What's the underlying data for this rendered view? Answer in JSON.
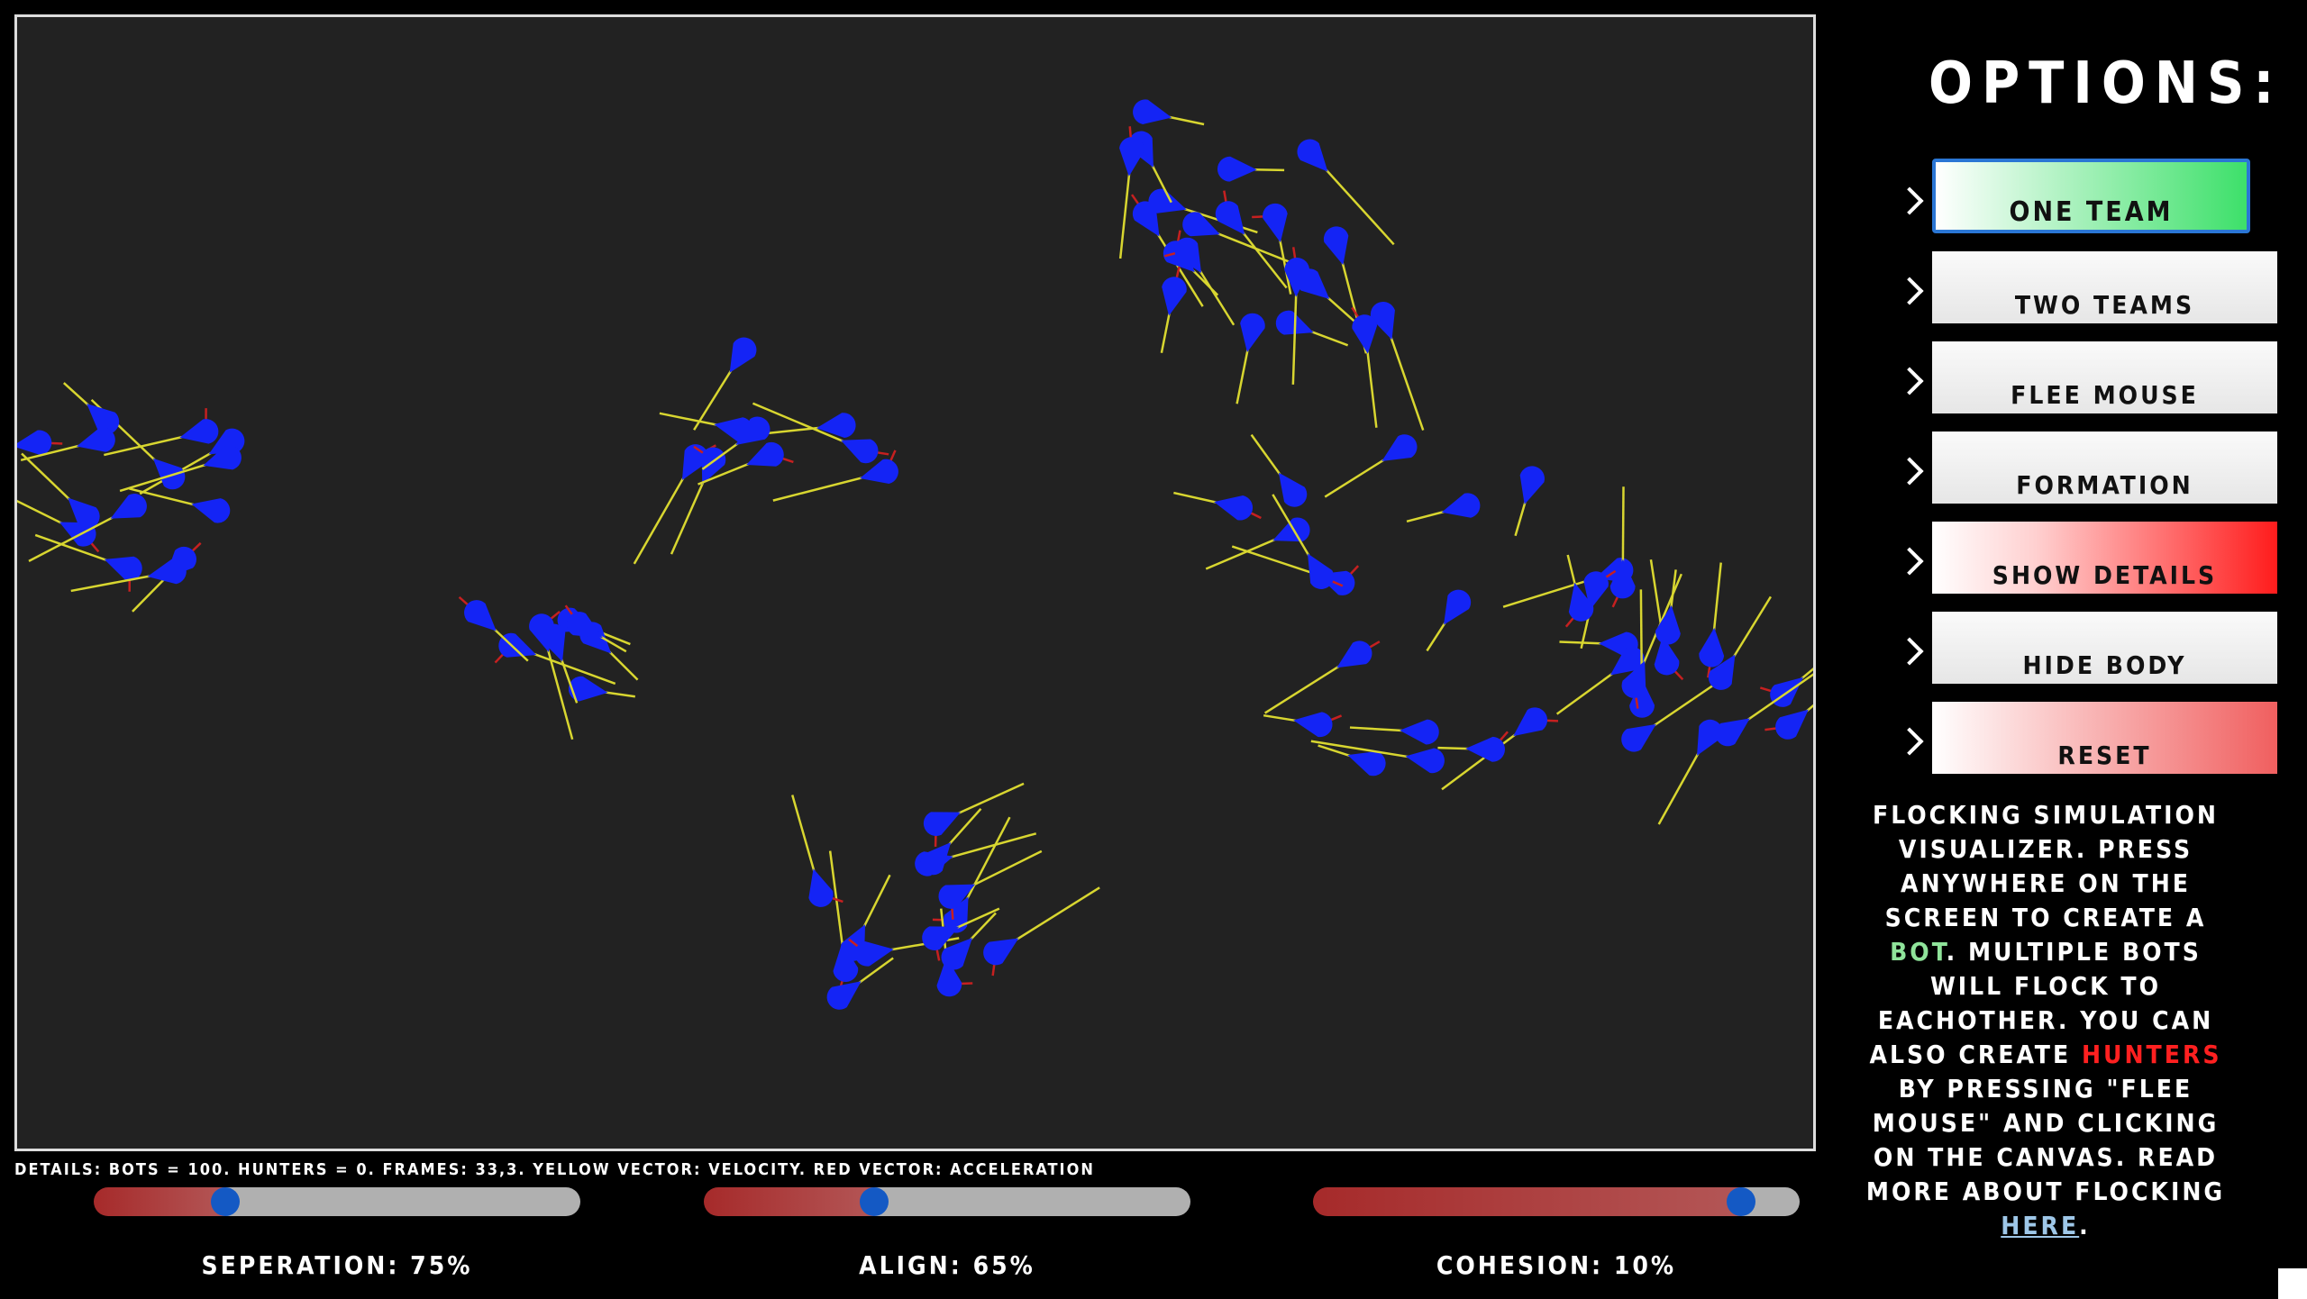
{
  "canvas": {
    "background": "#222222",
    "bot_color": "#1424f5",
    "velocity_color": "#d8d630",
    "acceleration_color": "#c62020"
  },
  "details_text": "DETAILS: BOTS = 100. HUNTERS = 0. FRAMES: 33,3. YELLOW VECTOR: VELOCITY. RED VECTOR: ACCELERATION",
  "sliders": [
    {
      "label": "SEPERATION: 75%",
      "value": 0.27
    },
    {
      "label": "ALIGN: 65%",
      "value": 0.35
    },
    {
      "label": "COHESION: 10%",
      "value": 0.88
    }
  ],
  "options": {
    "title": "OPTIONS:",
    "buttons": [
      {
        "label": "ONE TEAM",
        "color": "#3de06a"
      },
      {
        "label": "TWO TEAMS",
        "color": "#e6e6e6"
      },
      {
        "label": "FLEE MOUSE",
        "color": "#e6e6e6"
      },
      {
        "label": "FORMATION",
        "color": "#e6e6e6"
      },
      {
        "label": "SHOW DETAILS",
        "color": "#ff1c1c"
      },
      {
        "label": "HIDE BODY",
        "color": "#e6e6e6"
      },
      {
        "label": "RESET",
        "color": "#f05f5f"
      }
    ]
  },
  "description": {
    "part1": "FLOCKING SIMULATION VISUALIZER. PRESS ANYWHERE ON THE SCREEN TO CREATE A ",
    "bot": "BOT",
    "part2": ". MULTIPLE BOTS WILL FLOCK TO EACHOTHER. YOU CAN ALSO CREATE ",
    "hunters": "HUNTERS",
    "part3": " BY PRESSING \"FLEE MOUSE\" AND CLICKING ON THE CANVAS. READ MORE ABOUT FLOCKING ",
    "link": "HERE",
    "part4": "."
  }
}
